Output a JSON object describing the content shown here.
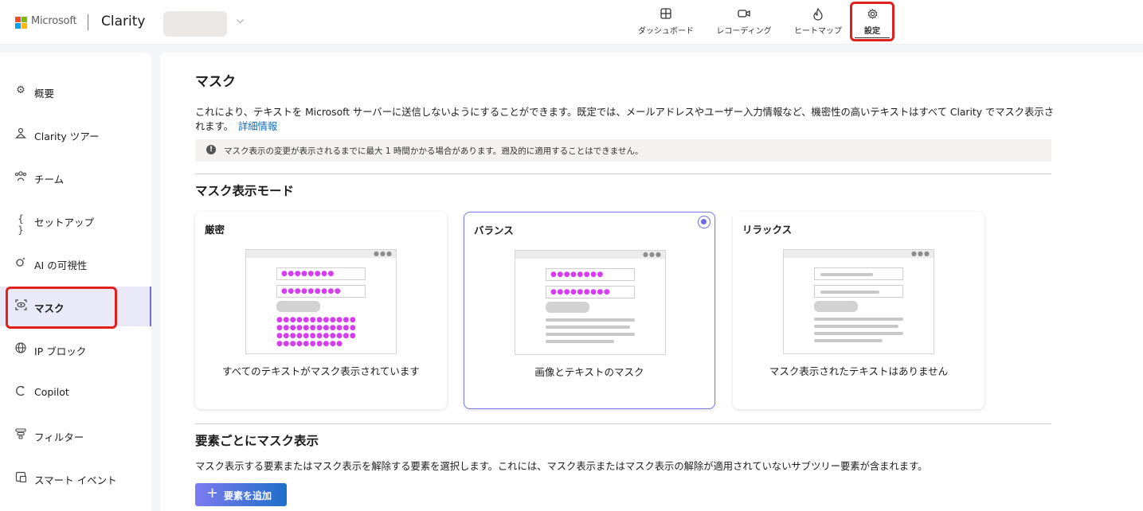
{
  "header": {
    "ms_word": "Microsoft",
    "brand": "Clarity",
    "chevron": "⌵",
    "nav": [
      {
        "label": "ダッシュボード",
        "icon": "dashboard-icon"
      },
      {
        "label": "レコーディング",
        "icon": "video-icon"
      },
      {
        "label": "ヒートマップ",
        "icon": "flame-icon"
      },
      {
        "label": "設定",
        "icon": "gear-icon"
      }
    ]
  },
  "sidebar": {
    "items": [
      {
        "label": "概要",
        "icon": "gear-icon"
      },
      {
        "label": "Clarity ツアー",
        "icon": "person-icon"
      },
      {
        "label": "チーム",
        "icon": "team-icon"
      },
      {
        "label": "セットアップ",
        "icon": "braces-icon"
      },
      {
        "label": "AI の可視性",
        "icon": "ai-icon"
      },
      {
        "label": "マスク",
        "icon": "mask-icon"
      },
      {
        "label": "IP ブロック",
        "icon": "globe-icon"
      },
      {
        "label": "Copilot",
        "icon": "copilot-icon"
      },
      {
        "label": "フィルター",
        "icon": "filter-icon"
      },
      {
        "label": "スマート イベント",
        "icon": "event-icon"
      }
    ]
  },
  "main": {
    "title": "マスク",
    "description": "これにより、テキストを Microsoft サーバーに送信しないようにすることができます。既定では、メールアドレスやユーザー入力情報など、機密性の高いテキストはすべて Clarity でマスク表示されます。",
    "learn_more": "詳細情報",
    "info_icon": "!",
    "info": "マスク表示の変更が表示されるまでに最大 1 時間かかる場合があります。遡及的に適用することはできません。",
    "mode_title": "マスク表示モード",
    "modes": [
      {
        "title": "厳密",
        "desc": "すべてのテキストがマスク表示されています"
      },
      {
        "title": "バランス",
        "desc": "画像とテキストのマスク"
      },
      {
        "title": "リラックス",
        "desc": "マスク表示されたテキストはありません"
      }
    ],
    "selected_mode": 1,
    "element_title": "要素ごとにマスク表示",
    "element_desc": "マスク表示する要素またはマスク表示を解除する要素を選択します。これには、マスク表示またはマスク表示の解除が適用されていないサブツリー要素が含まれます。",
    "add_button": "要素を追加",
    "add_icon": "+"
  },
  "colors": {
    "accent": "#6b6bde",
    "highlight": "#e0201b",
    "mask_dots": "#d63cf0",
    "link": "#0f6cbd"
  }
}
